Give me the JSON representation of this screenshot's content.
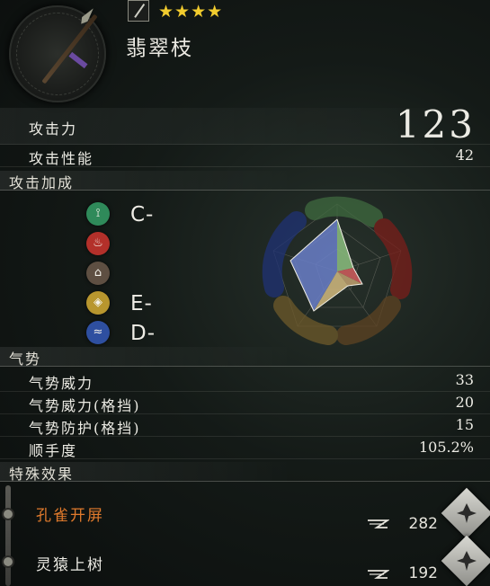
{
  "weapon": {
    "name": "翡翠枝",
    "stars": "★★★★"
  },
  "stats": {
    "attack_label": "攻击力",
    "attack_value": "123",
    "performance_label": "攻击性能",
    "performance_value": "42"
  },
  "scaling": {
    "header": "攻击加成",
    "items": [
      {
        "icon": "skill-icon",
        "color": "#2f8a5a",
        "glyph": "⟟",
        "grade": "C-"
      },
      {
        "icon": "fire-icon",
        "color": "#b3302a",
        "glyph": "♨",
        "grade": ""
      },
      {
        "icon": "earth-icon",
        "color": "#6b5a4a",
        "glyph": "⌂",
        "grade": ""
      },
      {
        "icon": "metal-icon",
        "color": "#b8962e",
        "glyph": "◈",
        "grade": "E-"
      },
      {
        "icon": "water-icon",
        "color": "#2e4fa0",
        "glyph": "≈",
        "grade": "D-"
      }
    ],
    "radar_colors": {
      "wood": "#5fa86a",
      "fire": "#b3302a",
      "earth": "#7a5a3a",
      "metal": "#b8962e",
      "water": "#2e4fa0"
    }
  },
  "ki": {
    "header": "气势",
    "rows": [
      {
        "label": "气势威力",
        "value": "33"
      },
      {
        "label": "气势威力(格挡)",
        "value": "20"
      },
      {
        "label": "气势防护(格挡)",
        "value": "15"
      },
      {
        "label": "顺手度",
        "value": "105.2%"
      }
    ]
  },
  "special": {
    "header": "特殊效果",
    "skills": [
      {
        "name": "孔雀开屏",
        "cost": "282",
        "name_color": "#e07a2c"
      },
      {
        "name": "灵猿上树",
        "cost": "192",
        "name_color": "#ecebe4"
      }
    ]
  }
}
